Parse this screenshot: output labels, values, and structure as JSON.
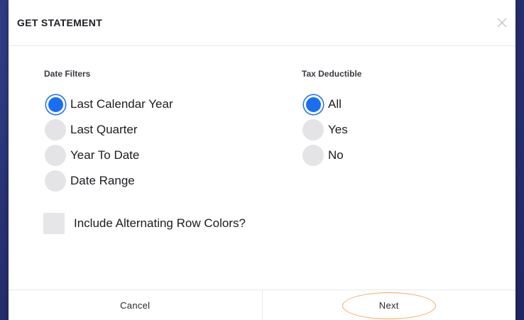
{
  "modal": {
    "title": "GET STATEMENT"
  },
  "icons": {
    "close": "close-icon"
  },
  "colors": {
    "accent": "#1a6ff0",
    "highlight_ring": "#f2a65a",
    "backdrop": "#2a3578"
  },
  "date_filters": {
    "heading": "Date Filters",
    "selected": "Last Calendar Year",
    "options": [
      {
        "label": "Last Calendar Year",
        "selected": true
      },
      {
        "label": "Last Quarter",
        "selected": false
      },
      {
        "label": "Year To Date",
        "selected": false
      },
      {
        "label": "Date Range",
        "selected": false
      }
    ]
  },
  "tax_deductible": {
    "heading": "Tax Deductible",
    "selected": "All",
    "options": [
      {
        "label": "All",
        "selected": true
      },
      {
        "label": "Yes",
        "selected": false
      },
      {
        "label": "No",
        "selected": false
      }
    ]
  },
  "alternating_rows": {
    "label": "Include Alternating Row Colors?",
    "checked": false
  },
  "footer": {
    "cancel_label": "Cancel",
    "next_label": "Next"
  }
}
